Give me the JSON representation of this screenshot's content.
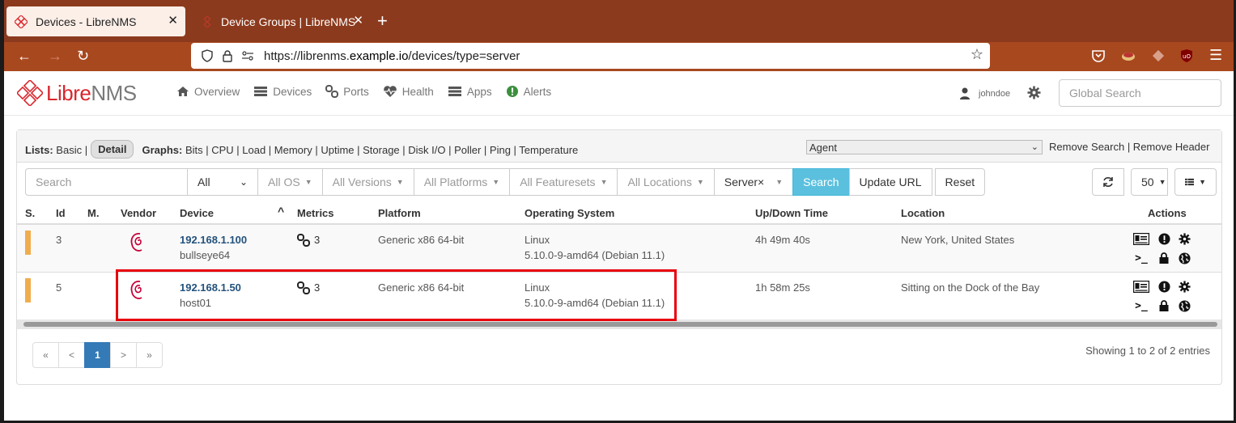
{
  "browser": {
    "tabs": [
      {
        "title": "Devices - LibreNMS",
        "active": true
      },
      {
        "title": "Device Groups | LibreNMS",
        "active": false
      }
    ],
    "url_prefix": "https://librenms.",
    "url_domain": "example.io",
    "url_path": "/devices/type=server"
  },
  "app": {
    "logo_libre": "Libre",
    "logo_nms": "NMS",
    "menu": [
      "Overview",
      "Devices",
      "Ports",
      "Health",
      "Apps",
      "Alerts"
    ],
    "username": "johndoe",
    "global_search_placeholder": "Global Search"
  },
  "panel": {
    "lists_label": "Lists:",
    "lists_basic": "Basic |",
    "lists_detail": "Detail",
    "graphs_label": "Graphs:",
    "graphs_links": "Bits | CPU | Load | Memory | Uptime | Storage | Disk I/O | Poller | Ping | Temperature",
    "agent_select": "Agent",
    "header_links": "Remove Search | Remove Header"
  },
  "filters": {
    "search_placeholder": "Search",
    "all": "All",
    "os": "All OS",
    "versions": "All Versions",
    "platforms": "All Platforms",
    "featuresets": "All Featuresets",
    "locations": "All Locations",
    "type": "Server×",
    "search_btn": "Search",
    "update_btn": "Update URL",
    "reset_btn": "Reset",
    "page_size": "50"
  },
  "table": {
    "headers": [
      "S.",
      "Id",
      "M.",
      "Vendor",
      "Device",
      "Metrics",
      "Platform",
      "Operating System",
      "Up/Down Time",
      "Location",
      "Actions"
    ],
    "rows": [
      {
        "id": "3",
        "ip": "192.168.1.100",
        "host": "bullseye64",
        "metrics": "3",
        "platform": "Generic x86 64-bit",
        "os": "Linux",
        "os_ver": "5.10.0-9-amd64 (Debian 11.1)",
        "uptime": "4h 49m 40s",
        "location": "New York, United States"
      },
      {
        "id": "5",
        "ip": "192.168.1.50",
        "host": "host01",
        "metrics": "3",
        "platform": "Generic x86 64-bit",
        "os": "Linux",
        "os_ver": "5.10.0-9-amd64 (Debian 11.1)",
        "uptime": "1h 58m 25s",
        "location": "Sitting on the Dock of the Bay"
      }
    ]
  },
  "pagination": {
    "first": "«",
    "prev": "<",
    "current": "1",
    "next": ">",
    "last": "»",
    "showing": "Showing 1 to 2 of 2 entries"
  },
  "colors": {
    "status_warning": "#f0ad4e",
    "highlight": "#e8000b",
    "link": "#23527c",
    "accent": "#5bc0de"
  }
}
